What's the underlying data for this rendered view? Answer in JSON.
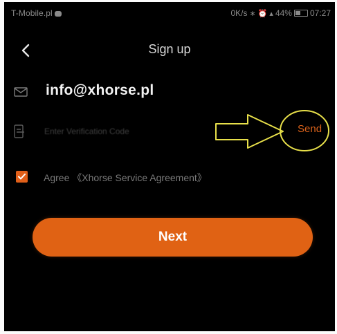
{
  "status_bar": {
    "carrier": "T-Mobile.pl",
    "speed": "0K/s",
    "signal": "44%",
    "time": "07:27",
    "icons": [
      "chat-icon",
      "bluetooth-icon",
      "alarm-icon",
      "signal-icon",
      "battery-icon"
    ]
  },
  "header": {
    "title": "Sign up",
    "back_icon": "chevron-left-icon"
  },
  "form": {
    "email": {
      "icon": "mail-icon",
      "value": "info@xhorse.pl"
    },
    "code": {
      "icon": "verification-code-icon",
      "placeholder": "Enter Verification Code",
      "value": "",
      "send_label": "Send"
    },
    "agree": {
      "checked": true,
      "label": "Agree 《Xhorse Service Agreement》"
    },
    "next_label": "Next"
  },
  "colors": {
    "accent": "#e06214",
    "annotation": "#e8e04a",
    "background": "#000000",
    "text_light": "#d8d8d8"
  }
}
